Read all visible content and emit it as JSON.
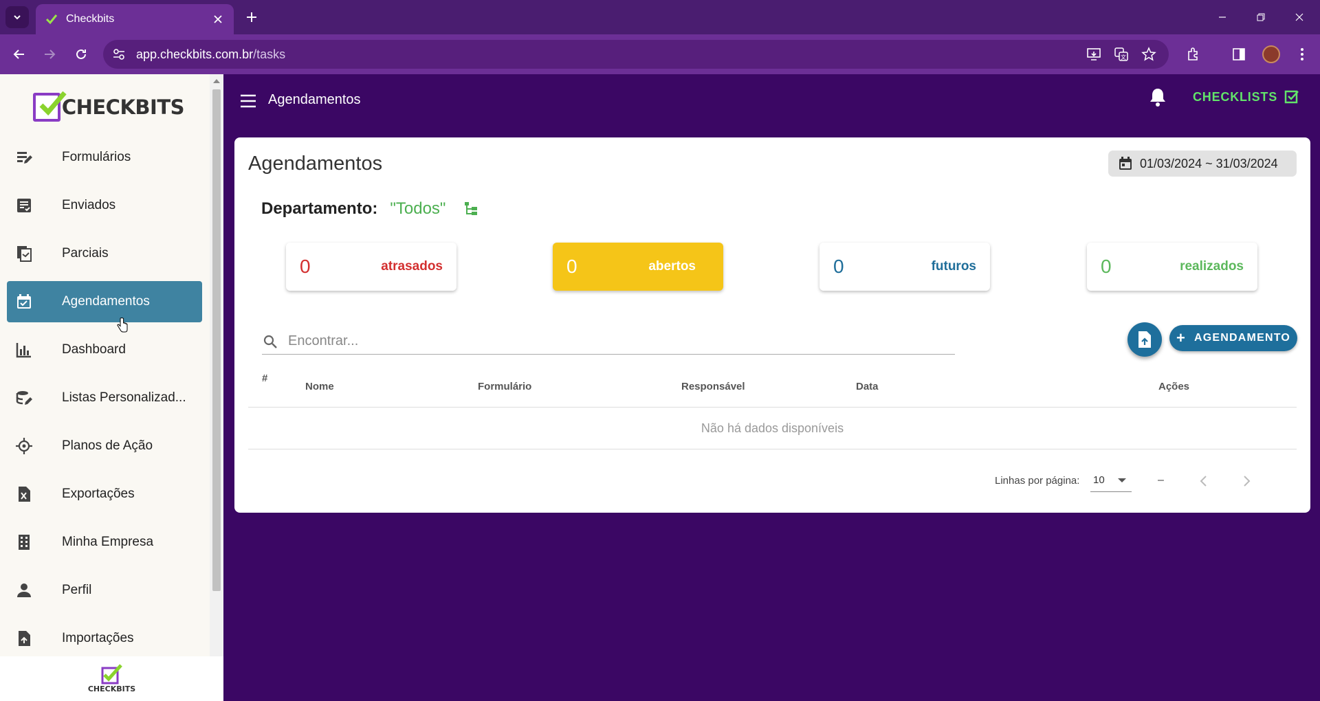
{
  "browser": {
    "tab_title": "Checkbits",
    "url_domain": "app.checkbits.com.br",
    "url_path": "/tasks"
  },
  "sidebar": {
    "logo_text": "CHECKBITS",
    "footer_logo_text": "CHECKBITS",
    "items": [
      {
        "label": "Formulários",
        "icon": "form-edit-icon"
      },
      {
        "label": "Enviados",
        "icon": "sent-list-icon"
      },
      {
        "label": "Parciais",
        "icon": "partial-docs-icon"
      },
      {
        "label": "Agendamentos",
        "icon": "calendar-check-icon",
        "active": true
      },
      {
        "label": "Dashboard",
        "icon": "bar-chart-icon"
      },
      {
        "label": "Listas Personalizad...",
        "icon": "database-edit-icon"
      },
      {
        "label": "Planos de Ação",
        "icon": "crosshair-icon"
      },
      {
        "label": "Exportações",
        "icon": "excel-file-icon"
      },
      {
        "label": "Minha Empresa",
        "icon": "building-icon"
      },
      {
        "label": "Perfil",
        "icon": "person-icon"
      },
      {
        "label": "Importações",
        "icon": "file-import-icon"
      }
    ]
  },
  "header": {
    "title": "Agendamentos",
    "checklists_label": "CHECKLISTS"
  },
  "main": {
    "title": "Agendamentos",
    "date_range": "01/03/2024 ~ 31/03/2024",
    "department_label": "Departamento:",
    "department_value": "\"Todos\"",
    "stats": [
      {
        "count": "0",
        "label": "atrasados",
        "color": "#d32f2f"
      },
      {
        "count": "0",
        "label": "abertos",
        "color": "#ffffff",
        "bg": "#f5c518"
      },
      {
        "count": "0",
        "label": "futuros",
        "color": "#1f6e9a"
      },
      {
        "count": "0",
        "label": "realizados",
        "color": "#5cb85c"
      }
    ],
    "search_placeholder": "Encontrar...",
    "add_button_label": "AGENDAMENTO",
    "table": {
      "columns": [
        "#",
        "Nome",
        "Formulário",
        "Responsável",
        "Data",
        "Ações"
      ],
      "empty_text": "Não há dados disponíveis"
    },
    "pagination": {
      "rows_per_page_label": "Linhas por página:",
      "rows_per_page_value": "10",
      "range_text": "–"
    }
  },
  "colors": {
    "background": "#3b0764",
    "browser_toolbar": "#6c2f96",
    "active_nav": "#3f83a1",
    "primary_button": "#1e6f9c",
    "checklists_green": "#62e36a"
  }
}
